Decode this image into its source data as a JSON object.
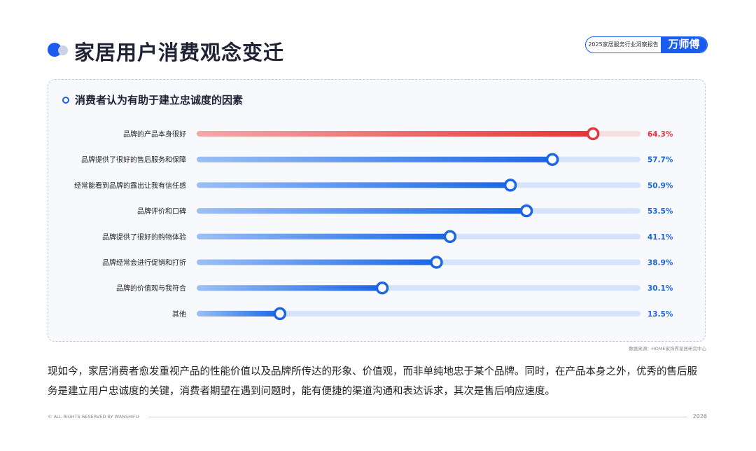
{
  "header": {
    "title": "家居用户消费观念变迁",
    "report_label": "2025家居服务行业洞察报告",
    "brand": "万师傅"
  },
  "panel": {
    "title": "消费者认为有助于建立忠诚度的因素"
  },
  "chart_data": {
    "type": "bar",
    "orientation": "horizontal",
    "title": "消费者认为有助于建立忠诚度的因素",
    "xlim": [
      0,
      72
    ],
    "categories": [
      "品牌的产品本身很好",
      "品牌提供了很好的售后服务和保障",
      "经常能看到品牌的露出让我有信任感",
      "品牌评价和口碑",
      "品牌提供了很好的购物体验",
      "品牌经常会进行促销和打折",
      "品牌的价值观与我符合",
      "其他"
    ],
    "values": [
      64.3,
      57.7,
      50.9,
      53.5,
      41.1,
      38.9,
      30.1,
      13.5
    ],
    "value_labels": [
      "64.3%",
      "57.7%",
      "50.9%",
      "53.5%",
      "41.1%",
      "38.9%",
      "30.1%",
      "13.5%"
    ],
    "highlight_index": 0,
    "colors": {
      "highlight": "#e5353a",
      "highlight_track": "#f6dfe0",
      "normal": "#1a66e6",
      "track": "#d5e4fa",
      "label_normal": "#1a66e6",
      "label_highlight": "#e5353a"
    },
    "grid": false,
    "legend": "none"
  },
  "source_note": "数据来源：HOME家饰界家居研究中心",
  "paragraph": [
    "现如今，家居消费者愈发重视产品的性能价值以及品牌所传达的形象、价值观，而非单纯地忠于某个品牌。同时，在产品本身之外，优秀的售后服",
    "务是建立用户忠诚度的关键，消费者期望在遇到问题时，能有便捷的渠道沟通和表达诉求，其次是售后响应速度。"
  ],
  "footer": {
    "rights": "© ALL RIGHTS RESERVED BY WANSHIFU",
    "year": "2026"
  }
}
